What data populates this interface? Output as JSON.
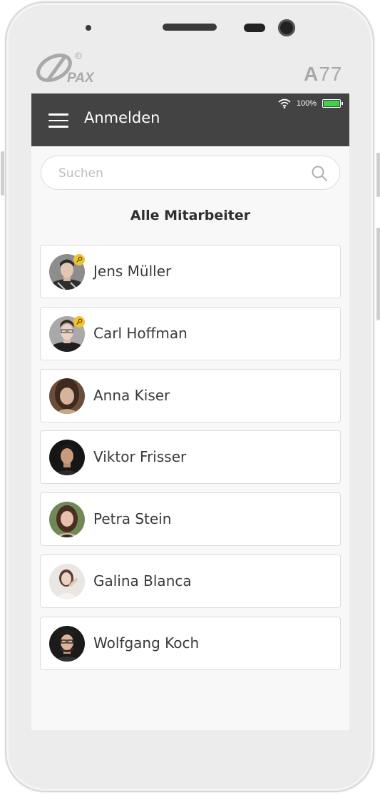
{
  "device": {
    "brand": "PAX",
    "model_letter": "A",
    "model_number": "77"
  },
  "status_bar": {
    "wifi_icon": "wifi-icon",
    "battery_text": "100%",
    "battery_level": 1.0,
    "battery_color": "#3cd24a"
  },
  "app_bar": {
    "menu_icon": "hamburger-menu-icon",
    "title": "Anmelden",
    "background": "#434343"
  },
  "search": {
    "placeholder": "Suchen",
    "value": "",
    "icon": "search-icon"
  },
  "section_title": "Alle Mitarbeiter",
  "employees": [
    {
      "name": "Jens Müller",
      "admin": true,
      "avatar": "avatar-photo"
    },
    {
      "name": "Carl Hoffman",
      "admin": true,
      "avatar": "avatar-photo"
    },
    {
      "name": "Anna Kiser",
      "admin": false,
      "avatar": "avatar-photo"
    },
    {
      "name": "Viktor Frisser",
      "admin": false,
      "avatar": "avatar-photo"
    },
    {
      "name": "Petra Stein",
      "admin": false,
      "avatar": "avatar-photo"
    },
    {
      "name": "Galina Blanca",
      "admin": false,
      "avatar": "avatar-photo"
    },
    {
      "name": "Wolfgang Koch",
      "admin": false,
      "avatar": "avatar-photo"
    }
  ],
  "colors": {
    "admin_badge": "#f2c230",
    "screen_bg": "#f8f8f8"
  }
}
